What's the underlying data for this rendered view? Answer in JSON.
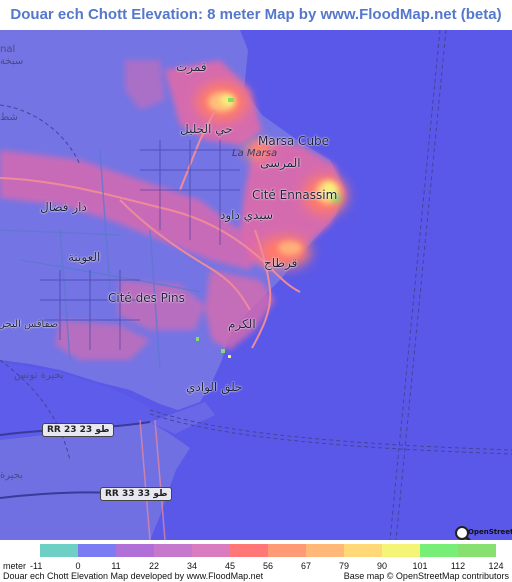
{
  "title": "Douar ech Chott Elevation: 8 meter Map by www.FloodMap.net (beta)",
  "places": {
    "marsa_cube": "Marsa Cube",
    "marsa_ar": "المرسى",
    "la_marsa": "La Marsa",
    "cite_ennassim": "Cité Ennassim",
    "gammarth_ar": "قمرت",
    "hay_el_khalil_ar": "حي الخليل",
    "sidi_daoud_ar": "سيدي داود",
    "dar_fadhal_ar": "دار فضال",
    "carthage_ar": "قرطاج",
    "aouina_ar": "العوينة",
    "cite_des_pins": "Cité des Pins",
    "soukra_edge_ar": "صفاقس البحر",
    "kram_ar": "الكرم",
    "halq_el_oued_ar": "حلق الوادي",
    "bhira_tunis_ar": "بحيرة تونس",
    "bhira_left_ar": "بحيرة",
    "edge_top_left_ar": "سبخة",
    "edge_left_mid_ar": "شط",
    "edge_top_left_latin": "nal"
  },
  "roads": {
    "rr23": "RR 23",
    "rr23_ar": "طو 23",
    "rr33": "RR 33",
    "rr33_ar": "طو 33"
  },
  "osm_logo_text": "OpenStreetMap",
  "legend": {
    "unit": "meter",
    "labels": [
      "-11",
      "0",
      "11",
      "22",
      "34",
      "45",
      "56",
      "67",
      "79",
      "90",
      "101",
      "112",
      "124"
    ],
    "colors": [
      "#6ecfc4",
      "#7b7bf2",
      "#b070d8",
      "#c578cc",
      "#d97cc0",
      "#ff7777",
      "#ff9a77",
      "#ffb877",
      "#ffd877",
      "#f4f477",
      "#77ee77",
      "#88e070"
    ]
  },
  "footer": {
    "left": "Douar ech Chott Elevation Map developed by www.FloodMap.net",
    "right": "Base map © OpenStreetMap contributors"
  },
  "colors": {
    "sea": "#5a58e8",
    "low_land": "#7474e4",
    "urban_pink": "#e86aa4",
    "hot_red": "#ff6f6f",
    "peak_yellow": "#f6f27a",
    "peak_green": "#7ee06a",
    "title_blue": "#5577cc"
  }
}
